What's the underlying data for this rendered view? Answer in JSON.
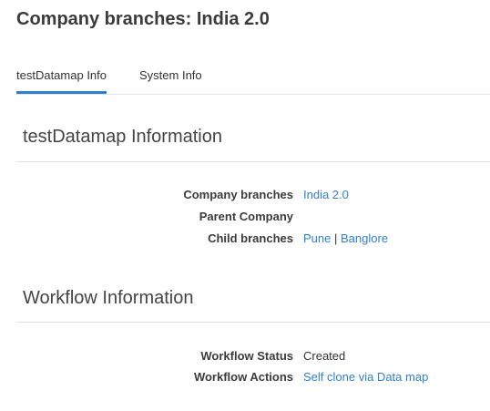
{
  "page": {
    "title": "Company branches: India 2.0"
  },
  "tabs": [
    {
      "label": "testDatamap Info",
      "active": true
    },
    {
      "label": "System Info",
      "active": false
    }
  ],
  "sections": {
    "datamap": {
      "title": "testDatamap Information",
      "fields": {
        "company_branches": {
          "label": "Company branches",
          "value": "India 2.0"
        },
        "parent_company": {
          "label": "Parent Company",
          "value": ""
        },
        "child_branches": {
          "label": "Child branches",
          "links": [
            "Pune",
            "Banglore"
          ],
          "separator": "|"
        }
      }
    },
    "workflow": {
      "title": "Workflow Information",
      "fields": {
        "status": {
          "label": "Workflow Status",
          "value": "Created"
        },
        "actions": {
          "label": "Workflow Actions",
          "value": "Self clone via Data map"
        }
      }
    }
  },
  "colors": {
    "link": "#2f7fd0",
    "active_tab_underline": "#2f7fd0",
    "rule": "#e3e3e3"
  }
}
